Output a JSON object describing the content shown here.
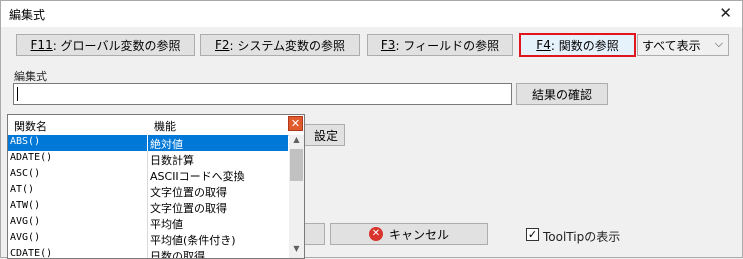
{
  "window": {
    "title": "編集式",
    "close_symbol": "✕"
  },
  "toolbar": {
    "btn_f11": {
      "key": "F11",
      "text": " : グローバル変数の参照"
    },
    "btn_f2": {
      "key": "F2",
      "text": " : システム変数の参照"
    },
    "btn_f3": {
      "key": "F3",
      "text": " : フィールドの参照"
    },
    "btn_f4": {
      "key": "F4",
      "text": " : 関数の参照"
    },
    "show_all": "すべて表示"
  },
  "editor": {
    "label": "編集式",
    "value": "",
    "confirm_label": "結果の確認"
  },
  "settings_button": "設定",
  "function_list": {
    "headers": [
      "関数名",
      "機能"
    ],
    "selected_index": 0,
    "rows": [
      [
        "ABS()",
        "絶対値"
      ],
      [
        "ADATE()",
        "日数計算"
      ],
      [
        "ASC()",
        "ASCIIコードへ変換"
      ],
      [
        "AT()",
        "文字位置の取得"
      ],
      [
        "ATW()",
        "文字位置の取得"
      ],
      [
        "AVG()",
        "平均値"
      ],
      [
        "AVG()",
        "平均値(条件付き)"
      ],
      [
        "CDATE()",
        "日数の取得"
      ]
    ]
  },
  "footer": {
    "cancel_label": "キャンセル",
    "tooltip_label": "ToolTipの表示",
    "tooltip_checked": true
  },
  "colors": {
    "accent": "#e0151d",
    "selection": "#0078d7"
  }
}
